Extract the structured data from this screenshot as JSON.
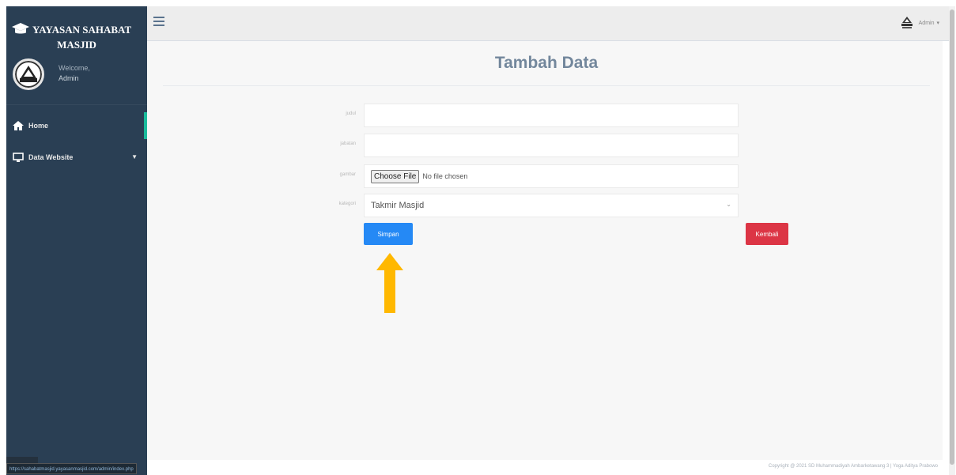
{
  "sidebar": {
    "brand_line1": "YAYASAN SAHABAT",
    "brand_line2": "MASJID",
    "welcome_label": "Welcome,",
    "user_name": "Admin",
    "items": [
      {
        "label": "Home",
        "icon": "home-icon",
        "active": true
      },
      {
        "label": "Data Website",
        "icon": "monitor-icon",
        "has_submenu": true
      }
    ]
  },
  "topbar": {
    "user_label": "Admin"
  },
  "page": {
    "title": "Tambah Data"
  },
  "form": {
    "fields": [
      {
        "label": "judul",
        "type": "text",
        "value": ""
      },
      {
        "label": "jabatan",
        "type": "text",
        "value": ""
      },
      {
        "label": "gambar",
        "type": "file",
        "button_label": "Choose File",
        "status": "No file chosen"
      },
      {
        "label": "kategori",
        "type": "select",
        "selected": "Takmir Masjid"
      }
    ],
    "save_label": "Simpan",
    "back_label": "Kembali"
  },
  "footer": {
    "copyright": "Copyright @ 2021 SD Muhammadiyah Ambarketawang 3 | Yoga Aditya Prabowo"
  },
  "status_url": "https://sahabatmasjid.yayasanmasjid.com/admin/index.php",
  "colors": {
    "sidebar_bg": "#2a3f54",
    "primary": "#2589f5",
    "danger": "#dc3545",
    "arrow": "#ffb800"
  }
}
